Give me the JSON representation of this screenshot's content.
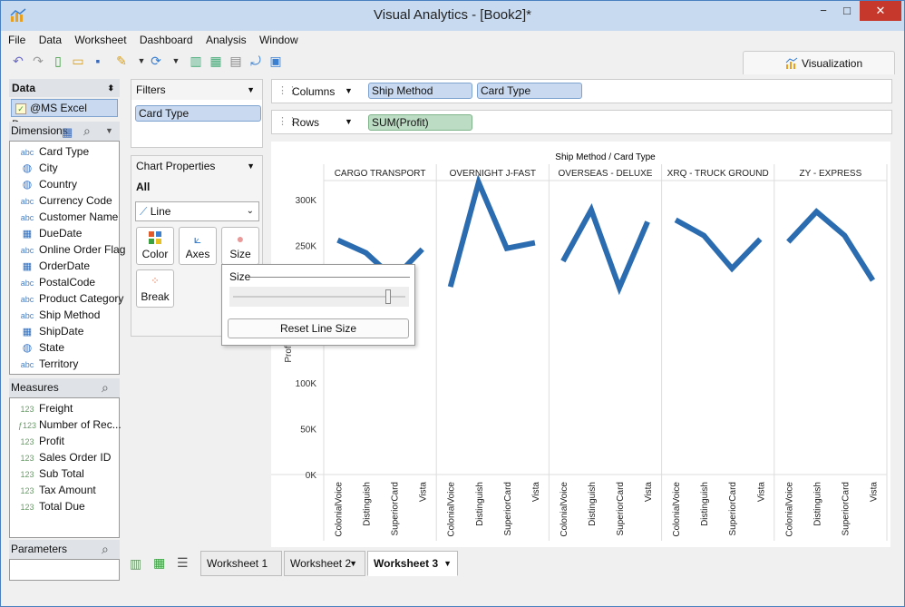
{
  "window": {
    "title": "Visual Analytics - [Book2]*",
    "min": "−",
    "max": "□",
    "close": "✕"
  },
  "menu": [
    "File",
    "Data",
    "Worksheet",
    "Dashboard",
    "Analysis",
    "Window"
  ],
  "visualization_tab": "Visualization",
  "data_panel": {
    "title": "Data",
    "source": "@MS Excel Doc..."
  },
  "dimensions": {
    "title": "Dimensions",
    "items": [
      {
        "type": "abc",
        "label": "Card Type"
      },
      {
        "type": "globe",
        "label": "City"
      },
      {
        "type": "globe",
        "label": "Country"
      },
      {
        "type": "abc",
        "label": "Currency Code"
      },
      {
        "type": "abc",
        "label": "Customer Name"
      },
      {
        "type": "cal",
        "label": "DueDate"
      },
      {
        "type": "abc",
        "label": "Online Order Flag"
      },
      {
        "type": "cal",
        "label": "OrderDate"
      },
      {
        "type": "abc",
        "label": "PostalCode"
      },
      {
        "type": "abc",
        "label": "Product Category"
      },
      {
        "type": "abc",
        "label": "Ship Method"
      },
      {
        "type": "cal",
        "label": "ShipDate"
      },
      {
        "type": "globe",
        "label": "State"
      },
      {
        "type": "abc",
        "label": "Territory"
      }
    ]
  },
  "measures": {
    "title": "Measures",
    "items": [
      {
        "type": "123",
        "label": "Freight"
      },
      {
        "type": "calc123",
        "label": "Number of Rec..."
      },
      {
        "type": "123",
        "label": "Profit"
      },
      {
        "type": "123",
        "label": "Sales Order ID"
      },
      {
        "type": "123",
        "label": "Sub Total"
      },
      {
        "type": "123",
        "label": "Tax Amount"
      },
      {
        "type": "123",
        "label": "Total Due"
      }
    ]
  },
  "parameters": {
    "title": "Parameters"
  },
  "filters": {
    "title": "Filters",
    "items": [
      "Card Type"
    ]
  },
  "chart_properties": {
    "title": "Chart Properties",
    "all_label": "All",
    "chart_type": "Line",
    "buttons": [
      "Color",
      "Axes",
      "Size",
      "Break"
    ]
  },
  "size_popup": {
    "title": "Size",
    "reset": "Reset Line Size",
    "slider_value": 0.9
  },
  "columns_shelf": {
    "label": "Columns",
    "pills": [
      "Ship Method",
      "Card Type"
    ]
  },
  "rows_shelf": {
    "label": "Rows",
    "pills": [
      "SUM(Profit)"
    ]
  },
  "tabs": [
    {
      "label": "Worksheet 1",
      "active": false
    },
    {
      "label": "Worksheet 2",
      "active": false
    },
    {
      "label": "Worksheet 3",
      "active": true
    }
  ],
  "chart_data": {
    "type": "line",
    "title": "Ship Method / Card Type",
    "ylabel": "Profit",
    "ylim": [
      0,
      320000
    ],
    "yticks": [
      "0K",
      "50K",
      "100K",
      "250K",
      "300K"
    ],
    "ytick_values": [
      0,
      50000,
      100000,
      250000,
      300000
    ],
    "categories": [
      "ColonialVoice",
      "Distinguish",
      "SuperiorCard",
      "Vista"
    ],
    "panels": [
      {
        "name": "CARGO TRANSPORT",
        "values": [
          256000,
          242000,
          214000,
          246000
        ]
      },
      {
        "name": "OVERNIGHT J-FAST",
        "values": [
          205000,
          319000,
          247000,
          253000
        ]
      },
      {
        "name": "OVERSEAS - DELUXE",
        "values": [
          233000,
          289000,
          204000,
          276000
        ]
      },
      {
        "name": "XRQ - TRUCK GROUND",
        "values": [
          278000,
          261000,
          225000,
          257000
        ]
      },
      {
        "name": "ZY - EXPRESS",
        "values": [
          254000,
          287000,
          261000,
          212000
        ]
      }
    ],
    "color": "#2b6cb0"
  }
}
